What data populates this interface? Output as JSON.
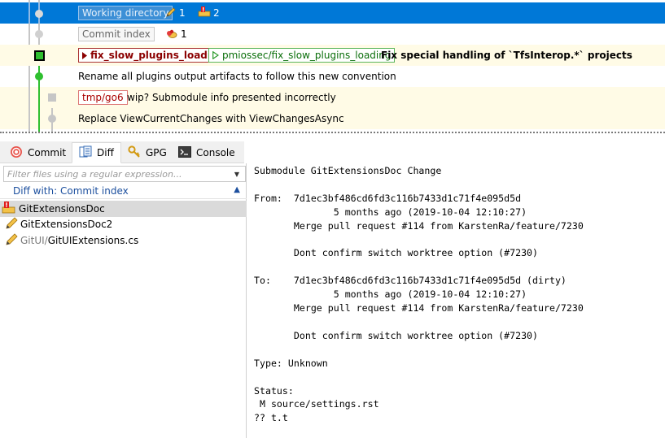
{
  "graph": {
    "rows": [
      {
        "kind": "working-dir",
        "label": "Working directory",
        "edit_count": "1",
        "conflict_count": "2"
      },
      {
        "kind": "commit-index",
        "label": "Commit index",
        "count": "1"
      },
      {
        "kind": "commit",
        "branch": "fix_slow_plugins_loading",
        "remote": "pmiossec/fix_slow_plugins_loading",
        "message": "Fix special handling of `TfsInterop.*` projects"
      },
      {
        "kind": "commit",
        "message": "Rename all plugins output artifacts to follow this new convention"
      },
      {
        "kind": "commit",
        "tag": "tmp/go6",
        "message": "wip? Submodule info presented incorrectly"
      },
      {
        "kind": "commit",
        "message": "Replace ViewCurrentChanges with ViewChangesAsync"
      }
    ]
  },
  "tabs": [
    {
      "label": "Commit",
      "icon": "commit-icon"
    },
    {
      "label": "Diff",
      "icon": "diff-icon",
      "active": true
    },
    {
      "label": "GPG",
      "icon": "key-icon"
    },
    {
      "label": "Console",
      "icon": "console-icon"
    }
  ],
  "filter": {
    "placeholder": "Filter files using a regular expression...",
    "value": ""
  },
  "diff_with": "Diff with: Commit index",
  "files": [
    {
      "name": "GitExtensionsDoc",
      "prefix": "",
      "icon": "submodule-conflict-icon",
      "selected": true
    },
    {
      "name": "GitExtensionsDoc2",
      "prefix": "",
      "icon": "pencil-icon"
    },
    {
      "name": "GitUIExtensions.cs",
      "prefix": "GitUI/",
      "icon": "pencil-icon"
    }
  ],
  "diff_text": "Submodule GitExtensionsDoc Change\n\nFrom:\t7d1ec3bf486cd6fd3c116b7433d1c71f4e095d5d\n\t\t5 months ago (2019-10-04 12:10:27)\n\tMerge pull request #114 from KarstenRa/feature/7230\n\n\tDont confirm switch worktree option (#7230)\n\nTo:\t7d1ec3bf486cd6fd3c116b7433d1c71f4e095d5d (dirty)\n\t\t5 months ago (2019-10-04 12:10:27)\n\tMerge pull request #114 from KarstenRa/feature/7230\n\n\tDont confirm switch worktree option (#7230)\n\nType: Unknown\n\nStatus:\n M source/settings.rst\n?? t.t",
  "colors": {
    "selection": "#0078d7",
    "graph_green": "#2fbf2f",
    "graph_gray": "#c6c6c6",
    "highlight_row": "#fffbe6"
  }
}
